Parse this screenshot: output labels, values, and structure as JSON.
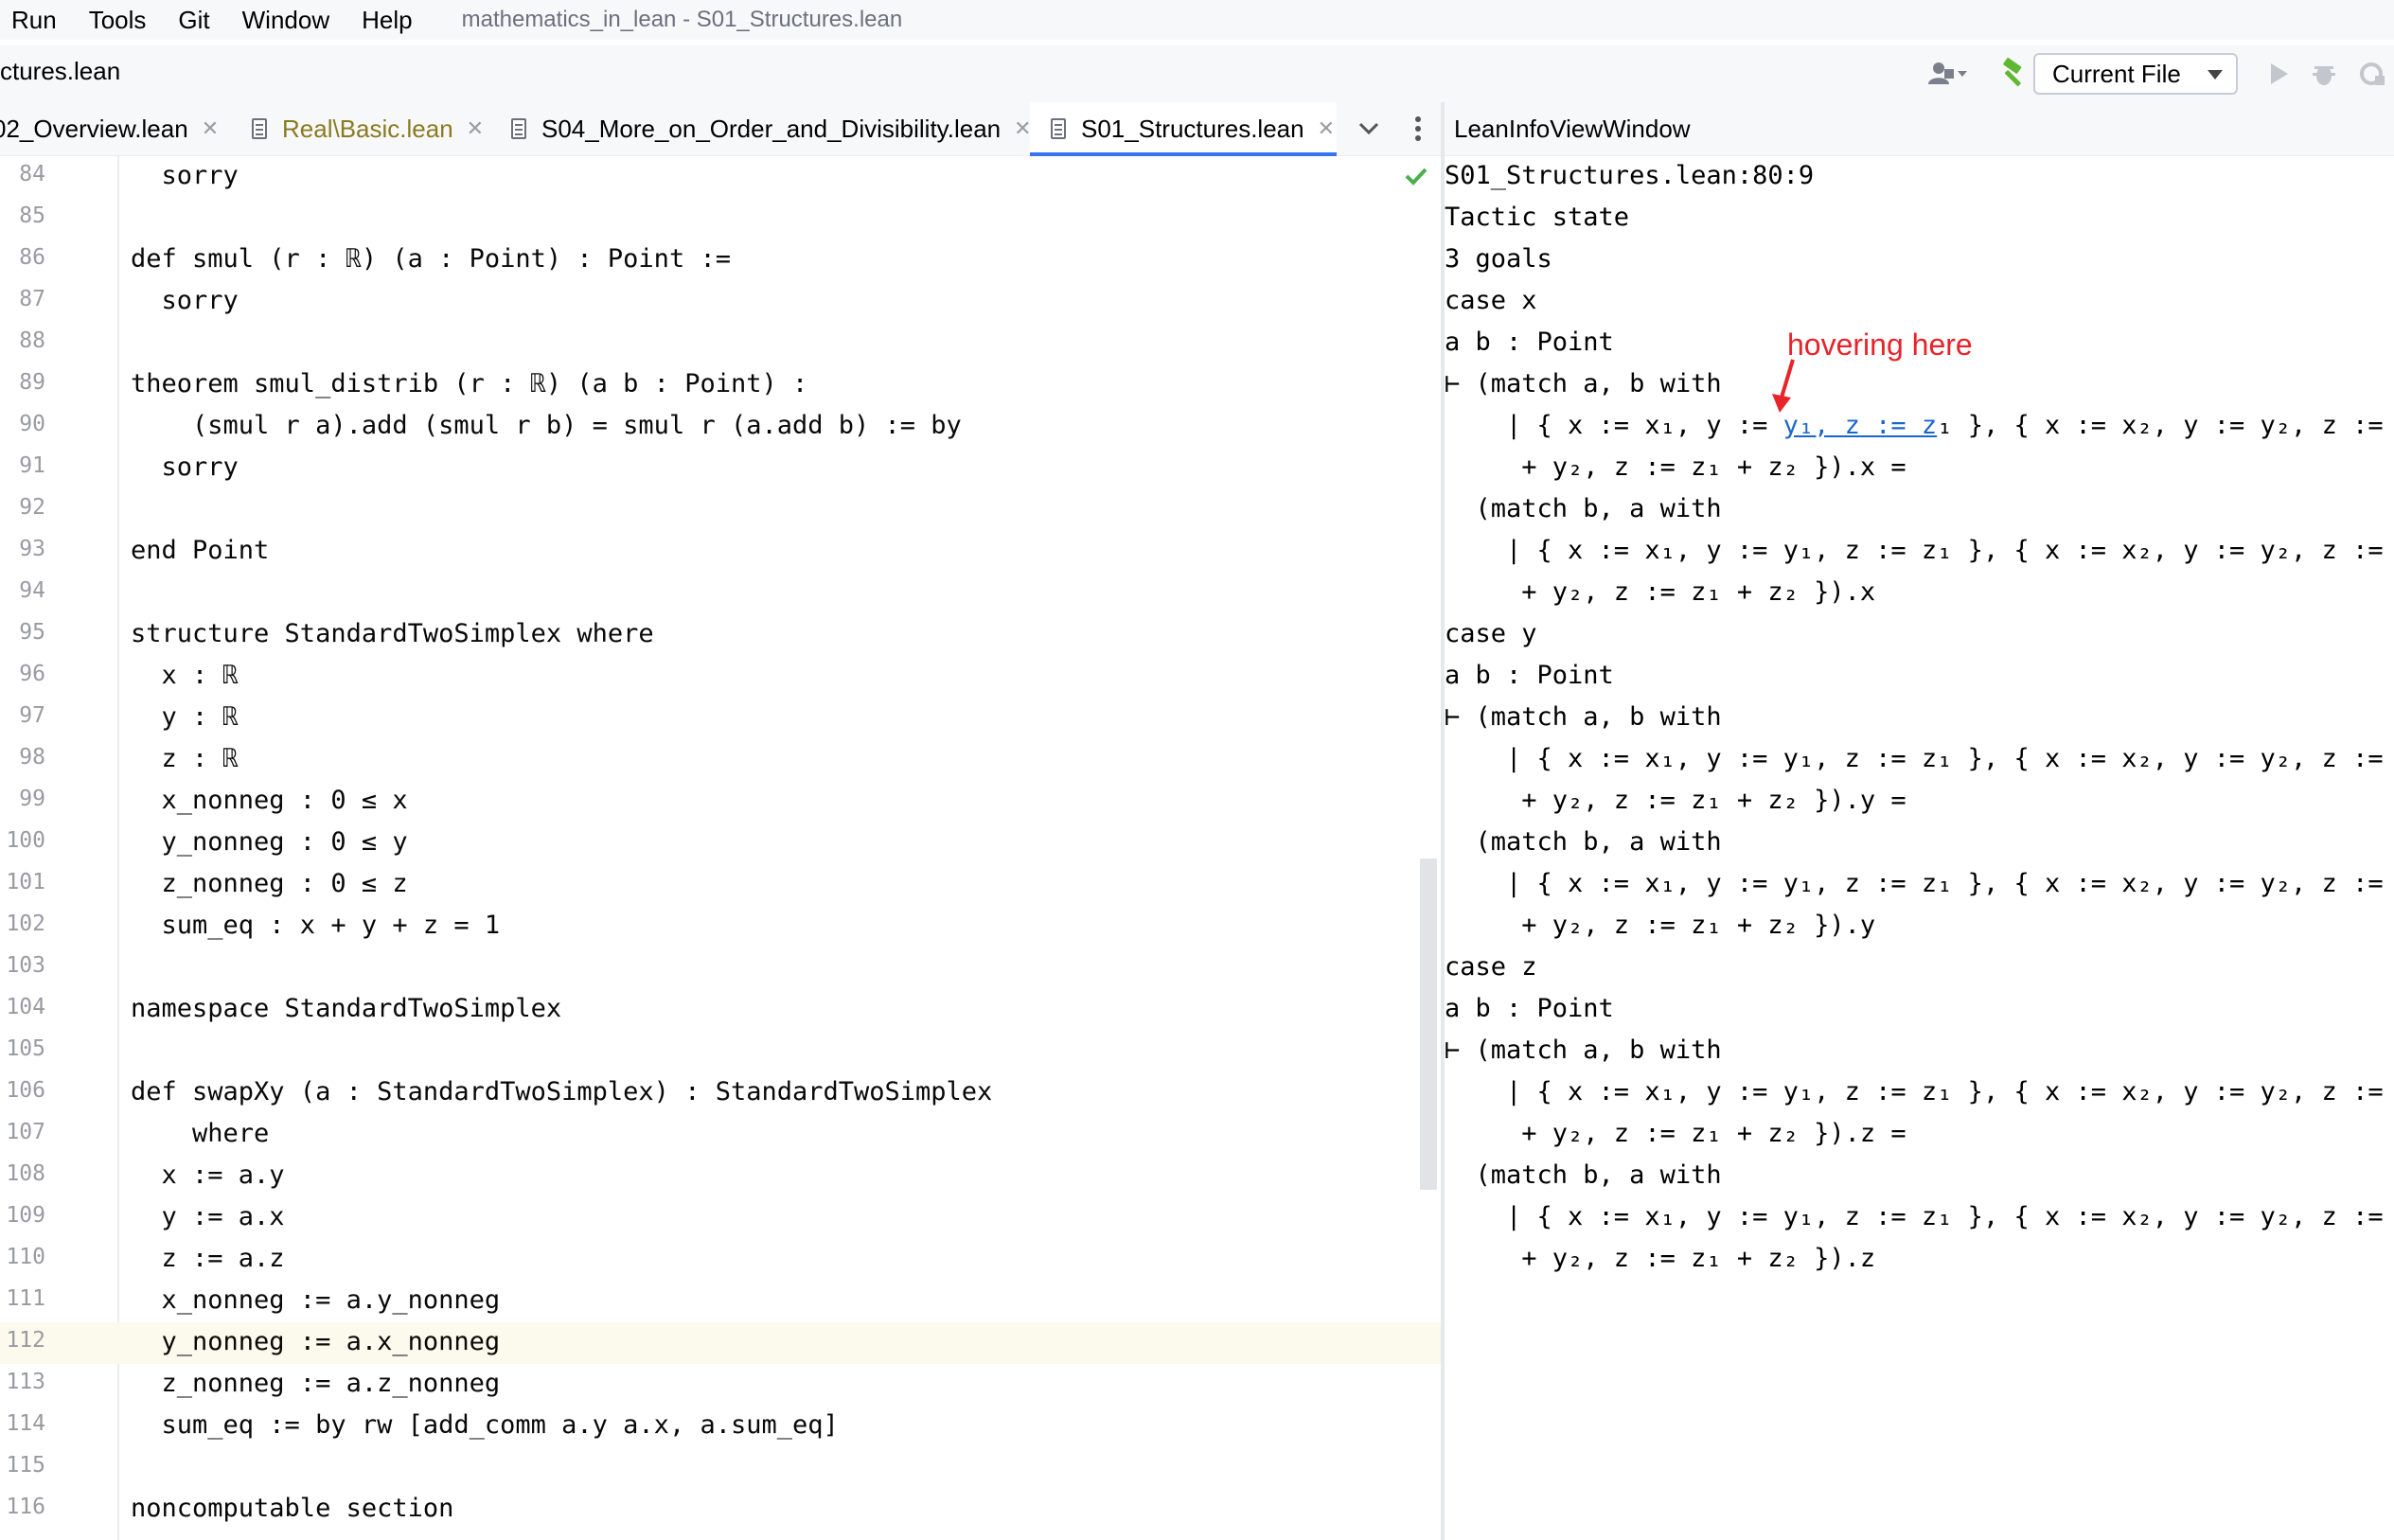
{
  "menu": {
    "items": [
      "Run",
      "Tools",
      "Git",
      "Window",
      "Help"
    ],
    "title": "mathematics_in_lean - S01_Structures.lean"
  },
  "navbar": {
    "breadcrumb": "ctures.lean",
    "run_config": "Current File",
    "icons": [
      "user-icon",
      "build-hammer-icon",
      "run-icon",
      "debug-icon",
      "coverage-icon"
    ]
  },
  "tabs": [
    {
      "label": "02_Overview.lean"
    },
    {
      "label": "Real\\Basic.lean"
    },
    {
      "label": "S04_More_on_Order_and_Divisibility.lean"
    },
    {
      "label": "S01_Structures.lean",
      "active": true
    }
  ],
  "editor": {
    "current_line": "112",
    "lines": [
      {
        "n": "84",
        "code": "  sorry"
      },
      {
        "n": "85",
        "code": ""
      },
      {
        "n": "86",
        "code": "def smul (r : ℝ) (a : Point) : Point :="
      },
      {
        "n": "87",
        "code": "  sorry"
      },
      {
        "n": "88",
        "code": ""
      },
      {
        "n": "89",
        "code": "theorem smul_distrib (r : ℝ) (a b : Point) :"
      },
      {
        "n": "90",
        "code": "    (smul r a).add (smul r b) = smul r (a.add b) := by"
      },
      {
        "n": "91",
        "code": "  sorry"
      },
      {
        "n": "92",
        "code": ""
      },
      {
        "n": "93",
        "code": "end Point"
      },
      {
        "n": "94",
        "code": ""
      },
      {
        "n": "95",
        "code": "structure StandardTwoSimplex where"
      },
      {
        "n": "96",
        "code": "  x : ℝ"
      },
      {
        "n": "97",
        "code": "  y : ℝ"
      },
      {
        "n": "98",
        "code": "  z : ℝ"
      },
      {
        "n": "99",
        "code": "  x_nonneg : 0 ≤ x"
      },
      {
        "n": "100",
        "code": "  y_nonneg : 0 ≤ y"
      },
      {
        "n": "101",
        "code": "  z_nonneg : 0 ≤ z"
      },
      {
        "n": "102",
        "code": "  sum_eq : x + y + z = 1"
      },
      {
        "n": "103",
        "code": ""
      },
      {
        "n": "104",
        "code": "namespace StandardTwoSimplex"
      },
      {
        "n": "105",
        "code": ""
      },
      {
        "n": "106",
        "code": "def swapXy (a : StandardTwoSimplex) : StandardTwoSimplex"
      },
      {
        "n": "107",
        "code": "    where"
      },
      {
        "n": "108",
        "code": "  x := a.y"
      },
      {
        "n": "109",
        "code": "  y := a.x"
      },
      {
        "n": "110",
        "code": "  z := a.z"
      },
      {
        "n": "111",
        "code": "  x_nonneg := a.y_nonneg"
      },
      {
        "n": "112",
        "code": "  y_nonneg := a.x_nonneg"
      },
      {
        "n": "113",
        "code": "  z_nonneg := a.z_nonneg"
      },
      {
        "n": "114",
        "code": "  sum_eq := by rw [add_comm a.y a.x, a.sum_eq]"
      },
      {
        "n": "115",
        "code": ""
      },
      {
        "n": "116",
        "code": "noncomputable section"
      }
    ]
  },
  "infoview": {
    "header": "LeanInfoViewWindow",
    "position": "S01_Structures.lean:80:9",
    "tactic_state": "Tactic state",
    "goals_count": "3 goals",
    "hover_before": "    | { x := x₁, y := ",
    "hover_link": "y₁, z := z",
    "hover_after": "₁ }, { x := x₂, y := y₂, z := z",
    "lines": [
      "case x",
      "a b : Point",
      "⊢ (match a, b with",
      null,
      "     + y₂, z := z₁ + z₂ }).x =",
      "  (match b, a with",
      "    | { x := x₁, y := y₁, z := z₁ }, { x := x₂, y := y₂, z := z",
      "     + y₂, z := z₁ + z₂ }).x",
      "case y",
      "a b : Point",
      "⊢ (match a, b with",
      "    | { x := x₁, y := y₁, z := z₁ }, { x := x₂, y := y₂, z := z",
      "     + y₂, z := z₁ + z₂ }).y =",
      "  (match b, a with",
      "    | { x := x₁, y := y₁, z := z₁ }, { x := x₂, y := y₂, z := z",
      "     + y₂, z := z₁ + z₂ }).y",
      "case z",
      "a b : Point",
      "⊢ (match a, b with",
      "    | { x := x₁, y := y₁, z := z₁ }, { x := x₂, y := y₂, z := z",
      "     + y₂, z := z₁ + z₂ }).z =",
      "  (match b, a with",
      "    | { x := x₁, y := y₁, z := z₁ }, { x := x₂, y := y₂, z := z",
      "     + y₂, z := z₁ + z₂ }).z"
    ]
  },
  "annotation": {
    "text": "hovering here",
    "color": "#e8232a"
  },
  "colors": {
    "accent": "#3574f0",
    "link": "#1a66cc",
    "check": "#4caf50",
    "hammer": "#5fb832"
  }
}
